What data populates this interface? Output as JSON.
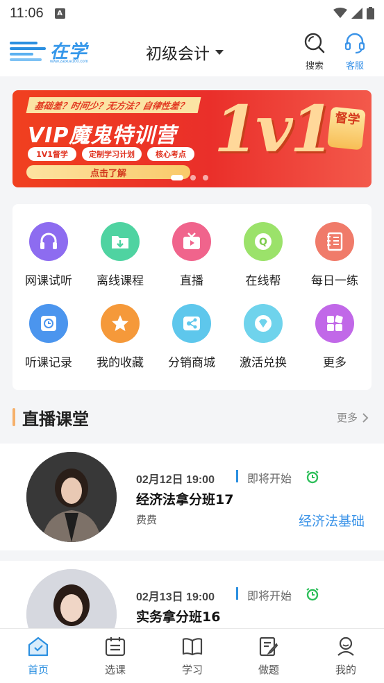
{
  "status_bar": {
    "time": "11:06",
    "notif_letter": "A"
  },
  "header": {
    "logo_text": "在学",
    "logo_site": "www.zaixue100.com",
    "title": "初级会计",
    "search_label": "搜索",
    "service_label": "客服"
  },
  "banner": {
    "tagline": "基础差？时间少？无方法？自律性差？",
    "main_text": "VIP魔鬼特训营",
    "pills": [
      "1V1督学",
      "定制学习计划",
      "核心考点"
    ],
    "cta": "点击了解",
    "big_text": "1v1",
    "badge": "督学"
  },
  "grid": {
    "items": [
      {
        "label": "网课试听",
        "icon": "headphones-icon",
        "color": "#8d6cf0"
      },
      {
        "label": "离线课程",
        "icon": "download-folder-icon",
        "color": "#4fd3a1"
      },
      {
        "label": "直播",
        "icon": "live-tv-icon",
        "color": "#f0648c"
      },
      {
        "label": "在线帮",
        "icon": "qa-icon",
        "color": "#9be26a"
      },
      {
        "label": "每日一练",
        "icon": "notebook-icon",
        "color": "#f07b6a"
      },
      {
        "label": "听课记录",
        "icon": "record-icon",
        "color": "#4b95ee"
      },
      {
        "label": "我的收藏",
        "icon": "star-icon",
        "color": "#f5993a"
      },
      {
        "label": "分销商城",
        "icon": "share-icon",
        "color": "#5ec7ec"
      },
      {
        "label": "激活兑换",
        "icon": "diamond-icon",
        "color": "#6fd3ec"
      },
      {
        "label": "更多",
        "icon": "more-grid-icon",
        "color": "#c168e8"
      }
    ]
  },
  "live_section": {
    "title": "直播课堂",
    "more": "更多"
  },
  "courses": [
    {
      "date": "02月12日 19:00",
      "status": "即将开始",
      "name": "经济法拿分班17",
      "teacher": "费费",
      "subject": "经济法基础"
    },
    {
      "date": "02月13日 19:00",
      "status": "即将开始",
      "name": "实务拿分班16",
      "teacher": "",
      "subject": ""
    }
  ],
  "tabs": [
    {
      "label": "首页",
      "icon": "home-icon",
      "active": true
    },
    {
      "label": "选课",
      "icon": "calendar-icon",
      "active": false
    },
    {
      "label": "学习",
      "icon": "book-icon",
      "active": false
    },
    {
      "label": "做题",
      "icon": "edit-icon",
      "active": false
    },
    {
      "label": "我的",
      "icon": "user-icon",
      "active": false
    }
  ],
  "colors": {
    "accent": "#2b8fe0",
    "banner_red": "#ea2f2a",
    "section_bar": "#f6b06a"
  }
}
